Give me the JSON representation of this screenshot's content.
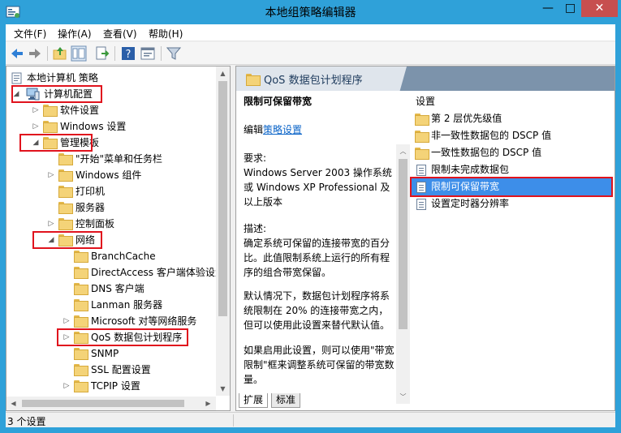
{
  "window": {
    "title": "本地组策略编辑器",
    "min_glyph": "—",
    "max_glyph": "□",
    "close_glyph": "✕"
  },
  "menu": [
    "文件(F)",
    "操作(A)",
    "查看(V)",
    "帮助(H)"
  ],
  "toolbar": {
    "icons": [
      "back-icon",
      "forward-icon",
      "up-folder-icon",
      "show-hide-tree-icon",
      "export-list-icon",
      "help-icon",
      "properties-icon",
      "filter-icon"
    ]
  },
  "tree": {
    "root": "本地计算机 策略",
    "computer_config": "计算机配置",
    "software_settings": "软件设置",
    "windows_settings": "Windows 设置",
    "admin_templates": "管理模板",
    "start_menu": "\"开始\"菜单和任务栏",
    "windows_components": "Windows 组件",
    "printers": "打印机",
    "servers": "服务器",
    "control_panel": "控制面板",
    "network": "网络",
    "branchcache": "BranchCache",
    "directaccess": "DirectAccess 客户端体验设置",
    "dns_client": "DNS 客户端",
    "lanman_server": "Lanman 服务器",
    "ms_p2p": "Microsoft 对等网络服务",
    "qos": "QoS 数据包计划程序",
    "snmp": "SNMP",
    "ssl": "SSL 配置设置",
    "tcpip": "TCPIP 设置"
  },
  "right": {
    "header_title": "QoS 数据包计划程序",
    "desc": {
      "heading": "限制可保留带宽",
      "edit_prefix": "编辑",
      "edit_link": "策略设置",
      "requirements_label": "要求:",
      "requirements_text": "Windows Server 2003 操作系统或 Windows XP Professional 及以上版本",
      "description_label": "描述:",
      "description_text": "确定系统可保留的连接带宽的百分比。此值限制系统上运行的所有程序的组合带宽保留。",
      "default_text": "默认情况下，数据包计划程序将系统限制在 20% 的连接带宽之内，但可以使用此设置来替代默认值。",
      "enable_text": "如果启用此设置，则可以使用\"带宽限制\"框来调整系统可保留的带宽数量。"
    },
    "list_header": "设置",
    "list": [
      {
        "label": "第 2 层优先级值",
        "icon": "folder-icon"
      },
      {
        "label": "非一致性数据包的 DSCP 值",
        "icon": "folder-icon"
      },
      {
        "label": "一致性数据包的 DSCP 值",
        "icon": "folder-icon"
      },
      {
        "label": "限制未完成数据包",
        "icon": "policy-setting-icon"
      },
      {
        "label": "限制可保留带宽",
        "icon": "policy-setting-icon",
        "selected": true
      },
      {
        "label": "设置定时器分辨率",
        "icon": "policy-setting-icon"
      }
    ]
  },
  "tabs": [
    "扩展",
    "标准"
  ],
  "status": "3 个设置",
  "colors": {
    "title_bg": "#2fa1d9",
    "highlight_box": "#e0131d",
    "selection": "#3d8ee9",
    "header_band": "#7c93ab",
    "close_button": "#c74f4f"
  }
}
